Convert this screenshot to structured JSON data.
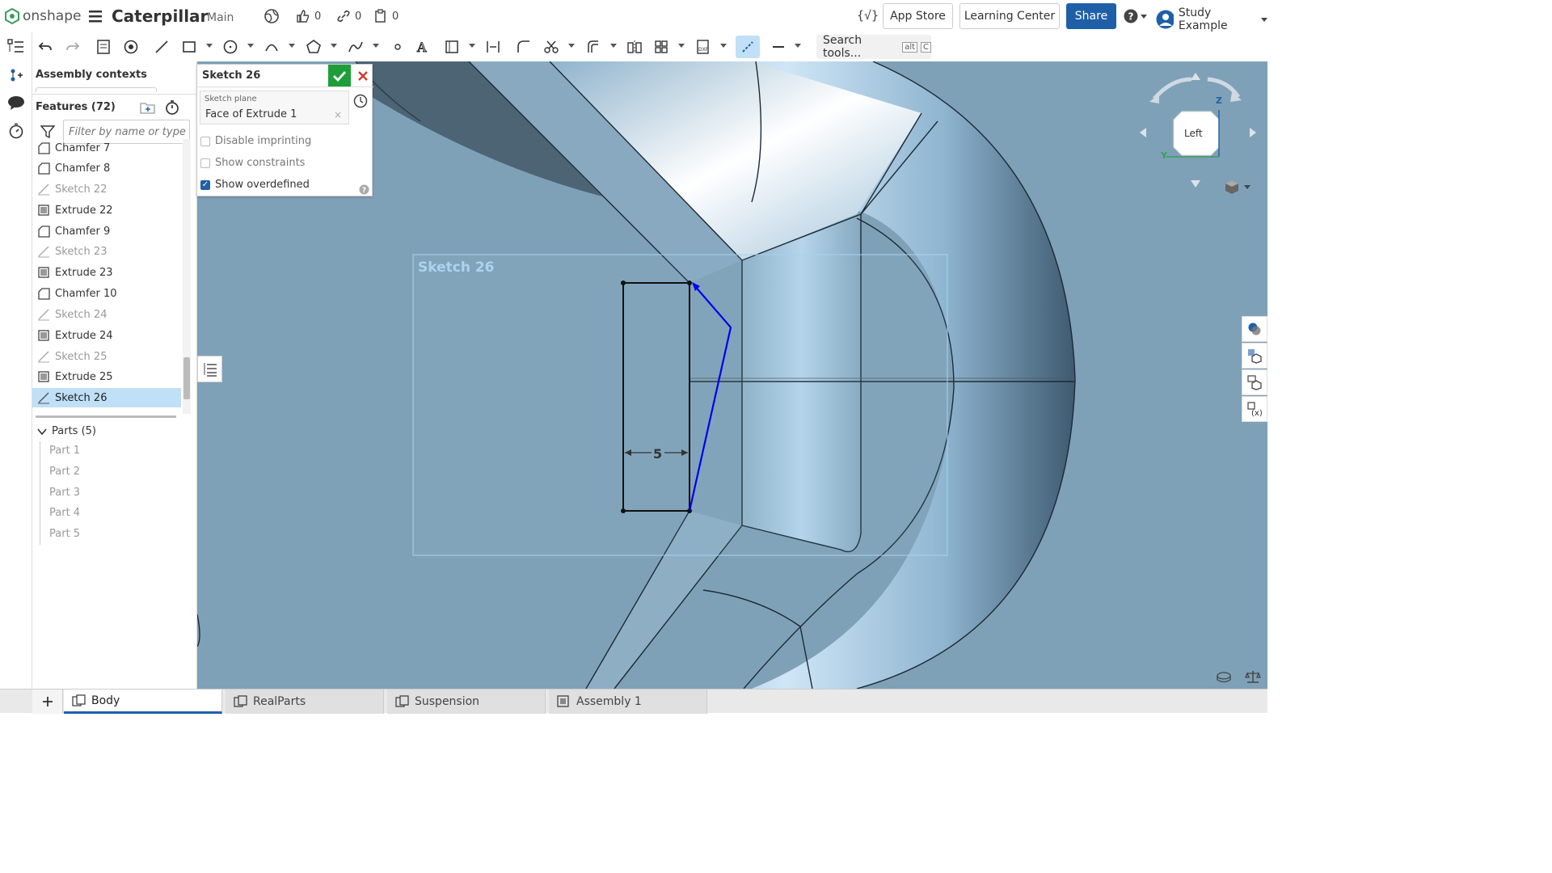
{
  "app": {
    "logo_text": "onshape",
    "doc_title": "Caterpillar",
    "branch": "Main"
  },
  "counters": {
    "likes": "0",
    "links": "0",
    "copies": "0"
  },
  "top_buttons": {
    "app_store": "App Store",
    "learning_center": "Learning Center",
    "share": "Share",
    "user": "Study Example"
  },
  "toolbar": {
    "search_tools": "Search tools...",
    "shortcut_a": "alt",
    "shortcut_b": "C"
  },
  "panel": {
    "assembly_contexts": "Assembly contexts",
    "features_title": "Features (72)",
    "filter_placeholder": "Filter by name or type",
    "features": [
      {
        "label": "Chamfer 7",
        "kind": "chamfer"
      },
      {
        "label": "Chamfer 8",
        "kind": "chamfer"
      },
      {
        "label": "Sketch 22",
        "kind": "sketch"
      },
      {
        "label": "Extrude 22",
        "kind": "extrude"
      },
      {
        "label": "Chamfer 9",
        "kind": "chamfer"
      },
      {
        "label": "Sketch 23",
        "kind": "sketch"
      },
      {
        "label": "Extrude 23",
        "kind": "extrude"
      },
      {
        "label": "Chamfer 10",
        "kind": "chamfer"
      },
      {
        "label": "Sketch 24",
        "kind": "sketch"
      },
      {
        "label": "Extrude 24",
        "kind": "extrude"
      },
      {
        "label": "Sketch 25",
        "kind": "sketch"
      },
      {
        "label": "Extrude 25",
        "kind": "extrude"
      },
      {
        "label": "Sketch 26",
        "kind": "sketch-selected"
      }
    ],
    "parts_title": "Parts (5)",
    "parts": [
      "Part 1",
      "Part 2",
      "Part 3",
      "Part 4",
      "Part 5"
    ]
  },
  "sketch_dialog": {
    "title": "Sketch 26",
    "plane_label": "Sketch plane",
    "plane_value": "Face of Extrude 1",
    "disable_imprinting": "Disable imprinting",
    "show_constraints": "Show constraints",
    "show_overdefined": "Show overdefined"
  },
  "viewport": {
    "sketch_label": "Sketch 26",
    "dimension": "5",
    "view_cube_label": "Left",
    "axis_z": "Z",
    "axis_y": "Y"
  },
  "tabs": [
    "Body",
    "RealParts",
    "Suspension",
    "Assembly 1"
  ],
  "colors": {
    "accent": "#1f5fa8",
    "confirm": "#1e9e3a",
    "cancel": "#d03a2a",
    "sketch_blue": "#0000ee",
    "part_blue": "#7fa1b8"
  }
}
